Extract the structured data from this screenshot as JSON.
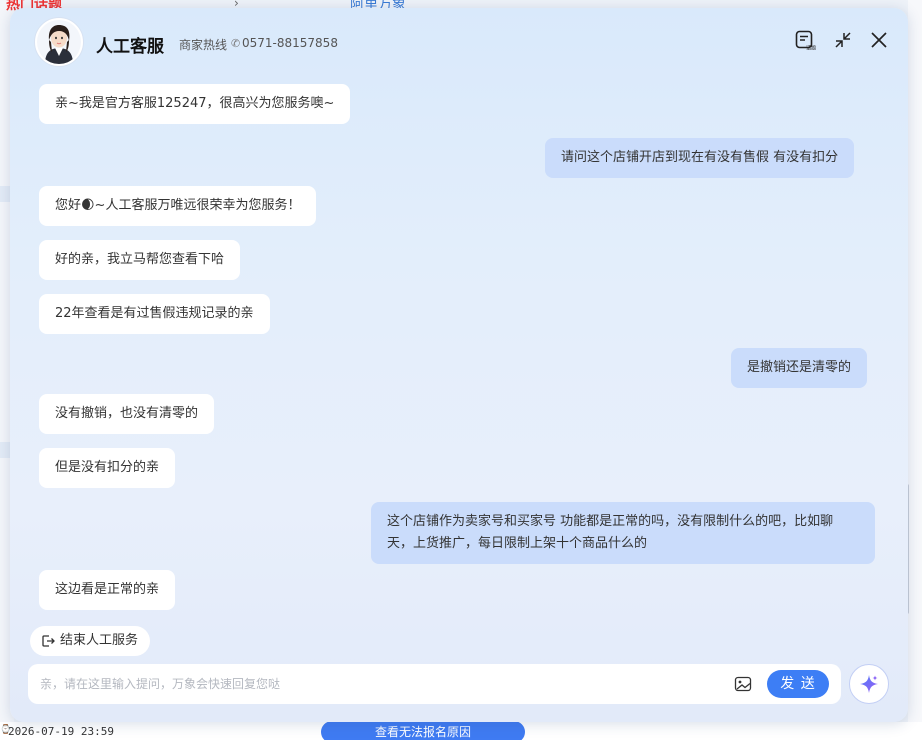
{
  "background": {
    "top_left_title": "热门话题",
    "top_right_title": "阿里万象",
    "date": "2026-07-19 23:59",
    "bottom_button": "查看无法报名原因"
  },
  "header": {
    "title": "人工客服",
    "hotline_label": "商家热线",
    "hotline_number": "0571-88157858",
    "record_icon_text": "话题"
  },
  "messages": [
    {
      "side": "in",
      "text": "亲~我是官方客服125247，很高兴为您服务噢~"
    },
    {
      "side": "out",
      "text": "请问这个店铺开店到现在有没有售假 有没有扣分"
    },
    {
      "side": "in",
      "text": "您好🌒~人工客服万唯远很荣幸为您服务！"
    },
    {
      "side": "in",
      "text": "好的亲，我立马帮您查看下哈"
    },
    {
      "side": "in",
      "text": "22年查看是有过售假违规记录的亲"
    },
    {
      "side": "out",
      "text": "是撤销还是清零的"
    },
    {
      "side": "in",
      "text": "没有撤销，也没有清零的"
    },
    {
      "side": "in",
      "text": "但是没有扣分的亲"
    },
    {
      "side": "out",
      "text": "这个店铺作为卖家号和买家号 功能都是正常的吗，没有限制什么的吧，比如聊天，上货推广，每日限制上架十个商品什么的"
    },
    {
      "side": "in",
      "text": "这边看是正常的亲"
    }
  ],
  "actions": {
    "end_service": "结束人工服务"
  },
  "input": {
    "placeholder": "亲，请在这里输入提问，万象会快速回复您哒",
    "value": "",
    "send_label": "发 送"
  },
  "colors": {
    "accent": "#3d7ef5",
    "outgoing_bubble": "#cadcfb",
    "incoming_bubble": "#ffffff"
  }
}
